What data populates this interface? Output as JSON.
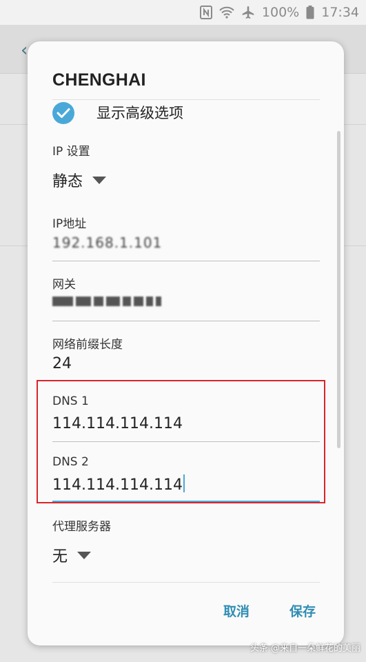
{
  "status_bar": {
    "battery": "100%",
    "time": "17:34",
    "icons": [
      "nfc-icon",
      "wifi-icon",
      "airplane-icon",
      "battery-icon"
    ]
  },
  "dialog": {
    "title": "CHENGHAI",
    "advanced_option_label": "显示高级选项",
    "advanced_option_checked": true,
    "ip_settings": {
      "label": "IP 设置",
      "value": "静态"
    },
    "ip_address": {
      "label": "IP地址",
      "value": "192.168.1.101"
    },
    "gateway": {
      "label": "网关",
      "value": ""
    },
    "prefix_length": {
      "label": "网络前缀长度",
      "value": "24"
    },
    "dns1": {
      "label": "DNS 1",
      "value": "114.114.114.114"
    },
    "dns2": {
      "label": "DNS 2",
      "value": "114.114.114.114"
    },
    "proxy": {
      "label": "代理服务器",
      "value": "无"
    },
    "cancel_label": "取消",
    "save_label": "保存"
  },
  "watermark": "头条 @来自一朵鲜花的美丽",
  "colors": {
    "accent": "#4aa8d8",
    "button_text": "#2f8db3",
    "highlight": "#d8232a"
  }
}
